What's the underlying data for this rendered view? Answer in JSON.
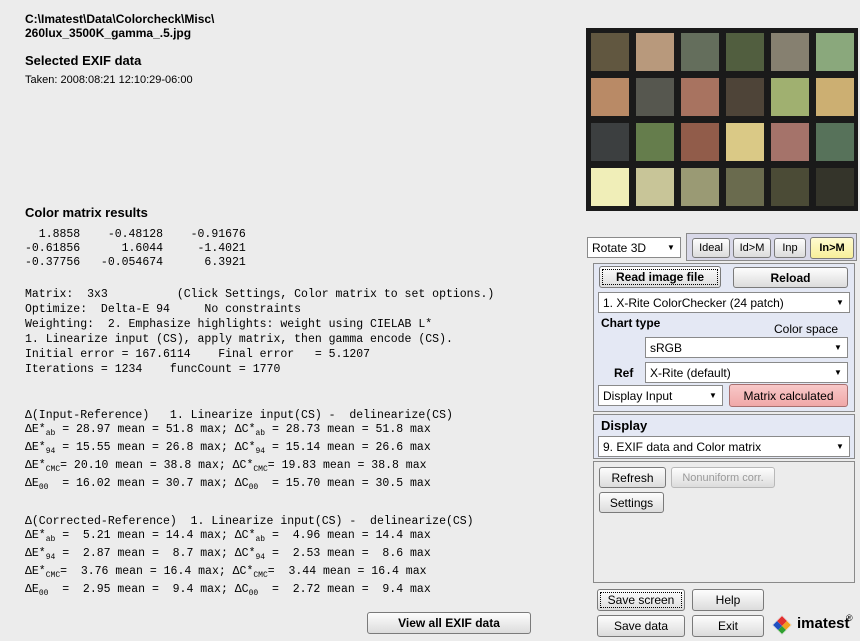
{
  "file": {
    "path_line1": "C:\\Imatest\\Data\\Colorcheck\\Misc\\",
    "path_line2": "260lux_3500K_gamma_.5.jpg"
  },
  "exif": {
    "heading": "Selected EXIF data",
    "taken": "Taken: 2008:08:21 12:10:29-06:00"
  },
  "color_matrix": {
    "heading": "Color matrix results",
    "rows": [
      "  1.8858    -0.48128    -0.91676",
      "-0.61856      1.6044     -1.4021",
      "-0.37756   -0.054674      6.3921"
    ]
  },
  "settings_text": [
    "Matrix:  3x3          (Click Settings, Color matrix to set options.)",
    "Optimize:  Delta-E 94     No constraints",
    "Weighting:  2. Emphasize highlights: weight using CIELAB L*",
    "1. Linearize input (CS), apply matrix, then gamma encode (CS).",
    "Initial error = 167.6114    Final error   = 5.1207",
    "Iterations = 1234    funcCount = 1770"
  ],
  "input_ref": {
    "title": "Δ(Input-Reference)   1. Linearize input(CS) -  delinearize(CS)",
    "rows": [
      {
        "e_sym": "ΔE*",
        "e_sub": "ab",
        "e_val": " = 28.97 mean = 51.8 max; ",
        "c_sym": "ΔC*",
        "c_sub": "ab",
        "c_val": " = 28.73 mean = 51.8 max"
      },
      {
        "e_sym": "ΔE*",
        "e_sub": "94",
        "e_val": " = 15.55 mean = 26.8 max; ",
        "c_sym": "ΔC*",
        "c_sub": "94",
        "c_val": " = 15.14 mean = 26.6 max"
      },
      {
        "e_sym": "ΔE*",
        "e_sub": "CMC",
        "e_val": "= 20.10 mean = 38.8 max; ",
        "c_sym": "ΔC*",
        "c_sub": "CMC",
        "c_val": "= 19.83 mean = 38.8 max"
      },
      {
        "e_sym": "ΔE",
        "e_sub": "00",
        "e_val": "  = 16.02 mean = 30.7 max; ",
        "c_sym": "ΔC",
        "c_sub": "00",
        "c_val": "  = 15.70 mean = 30.5 max"
      }
    ]
  },
  "corrected_ref": {
    "title": "Δ(Corrected-Reference)  1. Linearize input(CS) -  delinearize(CS)",
    "rows": [
      {
        "e_sym": "ΔE*",
        "e_sub": "ab",
        "e_val": " =  5.21 mean = 14.4 max; ",
        "c_sym": "ΔC*",
        "c_sub": "ab",
        "c_val": " =  4.96 mean = 14.4 max"
      },
      {
        "e_sym": "ΔE*",
        "e_sub": "94",
        "e_val": " =  2.87 mean =  8.7 max; ",
        "c_sym": "ΔC*",
        "c_sub": "94",
        "c_val": " =  2.53 mean =  8.6 max"
      },
      {
        "e_sym": "ΔE*",
        "e_sub": "CMC",
        "e_val": "=  3.76 mean = 16.4 max; ",
        "c_sym": "ΔC*",
        "c_sub": "CMC",
        "c_val": "=  3.44 mean = 16.4 max"
      },
      {
        "e_sym": "ΔE",
        "e_sub": "00",
        "e_val": "  =  2.95 mean =  9.4 max; ",
        "c_sym": "ΔC",
        "c_sub": "00",
        "c_val": "  =  2.72 mean =  9.4 max"
      }
    ]
  },
  "buttons": {
    "view_all_exif": "View all EXIF data",
    "ideal": "Ideal",
    "id_m": "Id>M",
    "inp": "Inp",
    "in_m": "In>M",
    "read_image": "Read image file",
    "reload": "Reload",
    "matrix_calculated": "Matrix calculated",
    "refresh": "Refresh",
    "nonuniform": "Nonuniform corr.",
    "settings": "Settings",
    "save_screen": "Save screen",
    "help": "Help",
    "save_data": "Save data",
    "exit": "Exit"
  },
  "selects": {
    "rotate": "Rotate 3D",
    "chart": "1.  X-Rite ColorChecker (24 patch)",
    "color_space": "sRGB",
    "ref": "X-Rite (default)",
    "display_input": "Display Input",
    "display": "9.  EXIF data and Color matrix"
  },
  "labels": {
    "chart_type": "Chart type",
    "color_space": "Color space",
    "ref": "Ref",
    "display": "Display"
  },
  "logo": {
    "text": "imatest",
    "reg": "®",
    "colors": [
      "#e03030",
      "#f0a020",
      "#30a030",
      "#2050c0"
    ]
  },
  "swatches": [
    "#615740",
    "#b8997c",
    "#646e5c",
    "#515e3f",
    "#868070",
    "#8aa87c",
    "#b98a66",
    "#56574f",
    "#a87360",
    "#4e4438",
    "#a0b070",
    "#ccaf72",
    "#3c3f40",
    "#657d4c",
    "#915c4a",
    "#dac986",
    "#a5736a",
    "#57725a",
    "#f0eeb8",
    "#c8c598",
    "#9a9a74",
    "#6a6b4e",
    "#4b4b36",
    "#34342a"
  ]
}
